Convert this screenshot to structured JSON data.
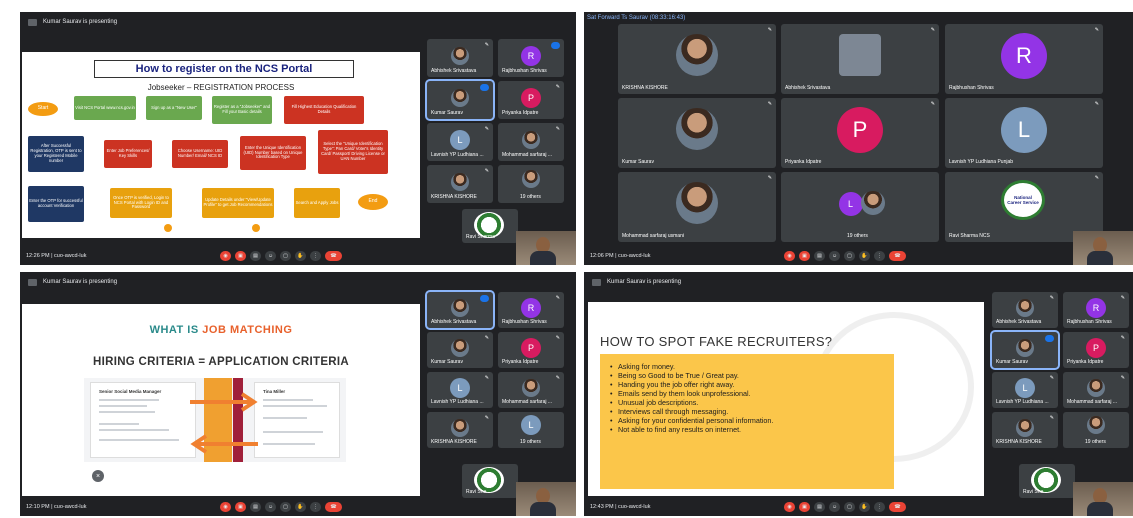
{
  "quad1": {
    "presenting": "Kumar Saurav is presenting",
    "clock": "12:26 PM",
    "meeting": "cuo-awcd-luk",
    "slide": {
      "title": "How to register on the NCS Portal",
      "subtitle": "Jobseeker – REGISTRATION PROCESS",
      "boxes": {
        "start": "Start",
        "visit": "Visit NCS Portal www.ncs.gov.in",
        "signup": "Sign up as a \"New User\"",
        "register": "Register as a \"Jobseeker\" and Fill your Basic details",
        "fill": "Fill Highest Education Qualification Details",
        "otp_sent": "After Successful Registration, OTP is sent to your Registered Mobile number",
        "enter_job": "Enter Job Preferences/ Key Skills",
        "username": "Choose Username: UID Number/ Email/ NCS ID",
        "enter_uid": "Enter the Unique Identification (UID) Number based on Unique Identification Type",
        "select_uid": "Select the \"Unique Identification Type\": Pan Card/ Voter's Identity Card/ Passport/ Driving License or UAN Number",
        "enter_otp": "Enter the OTP for successful account Verification",
        "once_otp": "Once OTP is verified, Login to NCS Portal with Login ID and Password",
        "update": "Update Details under \"View/Update Profile\" to get Job Recommendations",
        "search": "Search and Apply Jobs",
        "end": "End"
      }
    },
    "tiles": [
      {
        "name": "Abhishek Srivastava"
      },
      {
        "name": "Rajbhushan Shrivas",
        "letter": "R"
      },
      {
        "name": "Kumar Saurav"
      },
      {
        "name": "Priyanka Idpatre",
        "letter": "P"
      },
      {
        "name": "Lavnish YP Ludhiana ...",
        "letter": "L"
      },
      {
        "name": "Mohammad sarfaraj ..."
      },
      {
        "name": "KRISHNA KISHORE"
      },
      {
        "name": "19 others"
      },
      {
        "name": "Ravi Sharma"
      }
    ]
  },
  "quad2": {
    "top_text": "Sat Forward Ts Saurav (08:33:16:43)",
    "clock": "12:06 PM",
    "meeting": "cuo-awcd-luk",
    "tiles": [
      {
        "name": "KRISHNA KISHORE"
      },
      {
        "name": "Abhishek Srivastava"
      },
      {
        "name": "Rajbhushan Shrivas",
        "letter": "R"
      },
      {
        "name": "Kumar Saurav"
      },
      {
        "name": "Priyanka Idpatre",
        "letter": "P"
      },
      {
        "name": "Lavnish YP Ludhiana Punjab",
        "letter": "L"
      },
      {
        "name": "Mohammad sarfaraj usmani"
      },
      {
        "name": "19 others",
        "letter": "L"
      },
      {
        "name": "Ravi Sharma NCS",
        "logo_text": "National Career Service"
      }
    ]
  },
  "quad3": {
    "presenting": "Kumar Saurav is presenting",
    "clock": "12:10 PM",
    "meeting": "cuo-awcd-luk",
    "slide": {
      "title_a": "WHAT IS ",
      "title_b": "JOB MATCHING",
      "criteria": "HIRING CRITERIA   =   APPLICATION CRITERIA",
      "job_title": "Senior Social Media Manager",
      "candidate": "Tina Miller"
    },
    "tiles": [
      {
        "name": "Abhishek Srivastava"
      },
      {
        "name": "Rajbhushan Shrivas",
        "letter": "R"
      },
      {
        "name": "Kumar Saurav"
      },
      {
        "name": "Priyanka Idpatre",
        "letter": "P"
      },
      {
        "name": "Lavnish YP Ludhiana ...",
        "letter": "L"
      },
      {
        "name": "Mohammad sarfaraj ..."
      },
      {
        "name": "KRISHNA KISHORE"
      },
      {
        "name": "19 others",
        "letter": "L"
      },
      {
        "name": "Ravi Sha..."
      }
    ]
  },
  "quad4": {
    "presenting": "Kumar Saurav is presenting",
    "clock": "12:43 PM",
    "meeting": "cuo-awcd-luk",
    "slide": {
      "title": "HOW TO SPOT FAKE RECRUITERS?",
      "items": [
        "Asking for money.",
        "Being so Good to be True /  Great pay.",
        "Handing you the job offer right away.",
        "Emails send by them look unprofessional.",
        "Unusual job descriptions.",
        "Interviews call through messaging.",
        "Asking for your confidential personal information.",
        "Not able to find any results on internet."
      ]
    },
    "tiles": [
      {
        "name": "Abhishek Srivastava"
      },
      {
        "name": "Rajbhushan Shrivas",
        "letter": "R"
      },
      {
        "name": "Kumar Saurav"
      },
      {
        "name": "Priyanka Idpatre",
        "letter": "P"
      },
      {
        "name": "Lavnish YP Ludhiana ...",
        "letter": "L"
      },
      {
        "name": "Mohammad sarfaraj ..."
      },
      {
        "name": "KRISHNA KISHORE"
      },
      {
        "name": "19 others"
      },
      {
        "name": "Ravi Sha..."
      }
    ]
  },
  "colors": {
    "avatar_r": "#9334e6",
    "avatar_p": "#d81b60",
    "avatar_l": "#7c9bbd",
    "meet_bg": "#202124",
    "end_call": "#ea4335"
  }
}
